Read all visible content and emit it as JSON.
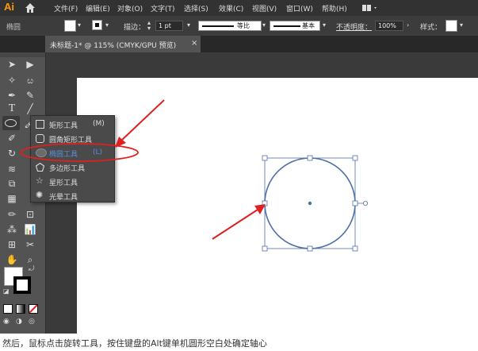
{
  "app": {
    "logo": "Ai"
  },
  "menubar": {
    "items": [
      "文件(F)",
      "编辑(E)",
      "对象(O)",
      "文字(T)",
      "选择(S)",
      "效果(C)",
      "视图(V)",
      "窗口(W)",
      "帮助(H)"
    ]
  },
  "controlbar": {
    "tool_name": "椭圆",
    "stroke_label": "描边：",
    "stroke_value": "1 pt",
    "uniform_label": "等比",
    "brush_label": "基本",
    "opacity_label": "不透明度：",
    "opacity_value": "100%",
    "style_label": "样式："
  },
  "document_tab": {
    "title": "未标题-1* @ 115% (CMYK/GPU 预览)",
    "close": "×"
  },
  "flyout": {
    "items": [
      {
        "label": "矩形工具",
        "shortcut": "(M)",
        "icon": "rectangle-icon"
      },
      {
        "label": "圆角矩形工具",
        "shortcut": "",
        "icon": "rounded-rectangle-icon"
      },
      {
        "label": "椭圆工具",
        "shortcut": "(L)",
        "icon": "ellipse-icon",
        "selected": true
      },
      {
        "label": "多边形工具",
        "shortcut": "",
        "icon": "polygon-icon"
      },
      {
        "label": "星形工具",
        "shortcut": "",
        "icon": "star-icon"
      },
      {
        "label": "光晕工具",
        "shortcut": "",
        "icon": "flare-icon"
      }
    ]
  },
  "caption": "然后，鼠标点击旋转工具，按住键盘的Alt键单机圆形空白处确定轴心",
  "colors": {
    "menubar_bg": "#323232",
    "panel_bg": "#535353",
    "annotation_red": "#e02020",
    "selection_blue": "#4f6fa8",
    "logo_orange": "#ff9a00"
  }
}
